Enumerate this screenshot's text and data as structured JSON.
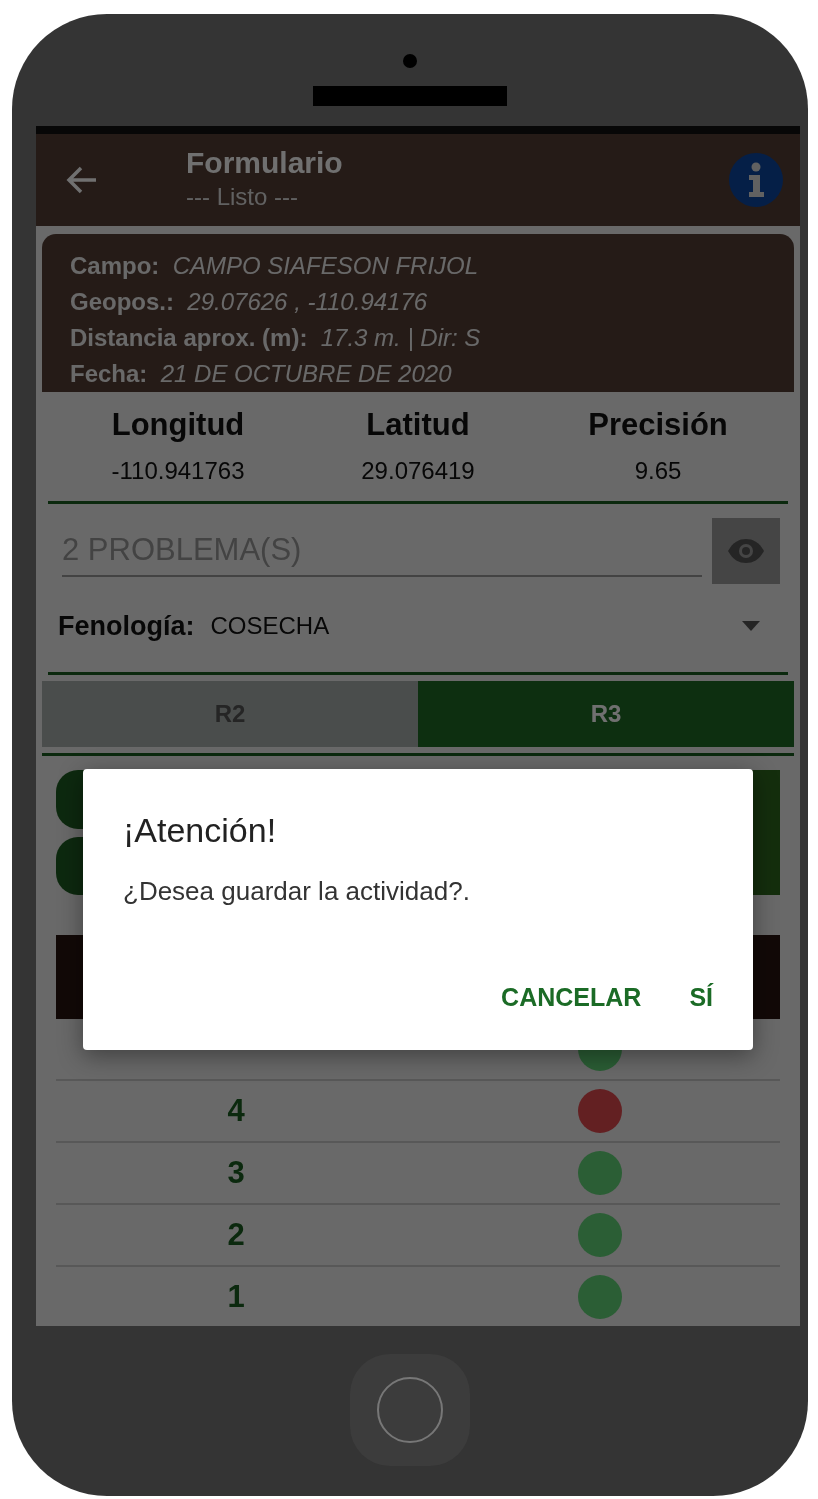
{
  "app_bar": {
    "title": "Formulario",
    "subtitle": "--- Listo ---"
  },
  "info_card": [
    {
      "label": "Campo:",
      "value": "CAMPO SIAFESON FRIJOL"
    },
    {
      "label": "Geopos.:",
      "value": "29.07626 , -110.94176"
    },
    {
      "label": "Distancia aprox. (m):",
      "value": "17.3 m. | Dir: S"
    },
    {
      "label": "Fecha:",
      "value": "21 DE OCTUBRE DE 2020"
    }
  ],
  "coordinates": [
    {
      "heading": "Longitud",
      "value": "-110.941763"
    },
    {
      "heading": "Latitud",
      "value": "29.076419"
    },
    {
      "heading": "Precisión",
      "value": "9.65"
    }
  ],
  "problems_field": {
    "placeholder": "2 PROBLEMA(S)"
  },
  "phenology": {
    "label": "Fenología:",
    "value": "COSECHA"
  },
  "stage_tabs": [
    {
      "label": "R2",
      "selected": false
    },
    {
      "label": "R3",
      "selected": true
    }
  ],
  "rows": [
    {
      "color": "#2b5e35"
    },
    {
      "number": "4",
      "color": "#632022"
    },
    {
      "number": "3",
      "color": "#2b5e35"
    },
    {
      "number": "2",
      "color": "#2b5e35"
    },
    {
      "number": "1",
      "color": "#2b5e35"
    }
  ],
  "dialog": {
    "title": "¡Atención!",
    "message": "¿Desea guardar la actividad?.",
    "buttons": [
      "CANCELAR",
      "SÍ"
    ]
  }
}
